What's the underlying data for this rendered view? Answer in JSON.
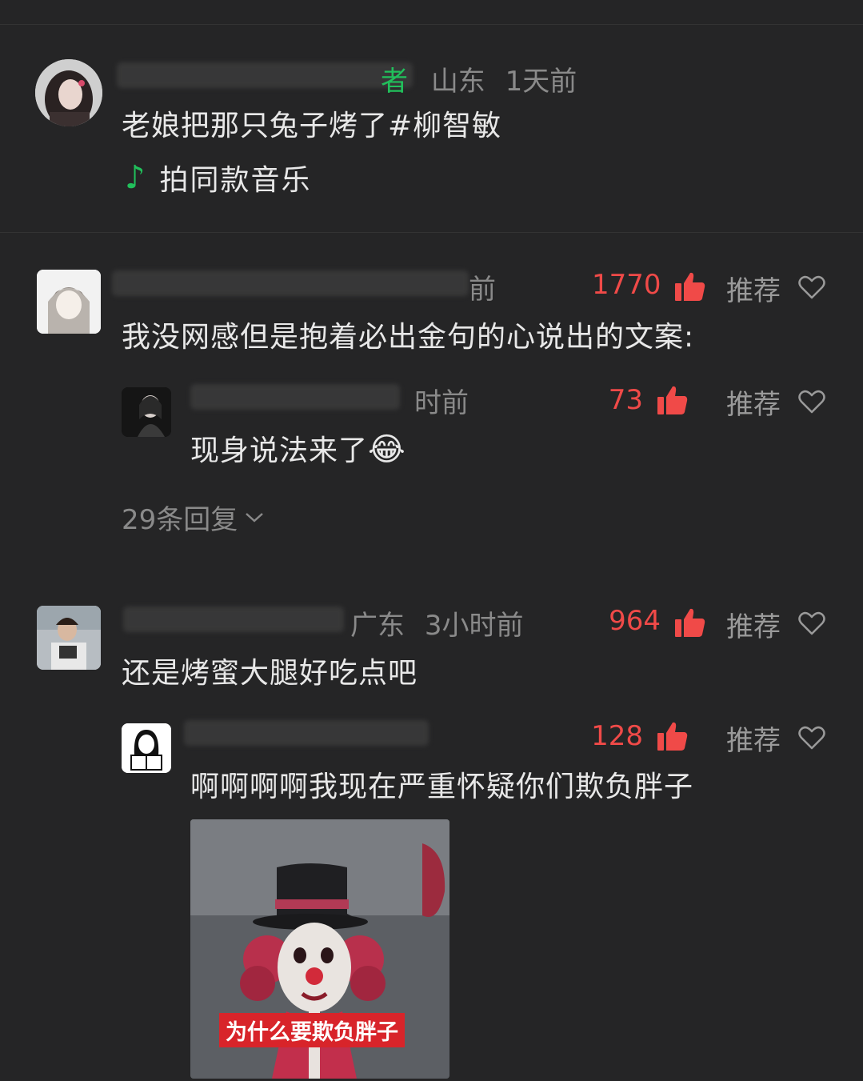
{
  "post": {
    "author_tag": "者",
    "location": "山东",
    "time": "1天前",
    "text": "老娘把那只兔子烤了",
    "hashtag": "#柳智敏",
    "music_label": "拍同款音乐",
    "music_icon": "music-note-icon"
  },
  "comments": [
    {
      "meta_visible": "前",
      "likes": "1770",
      "recommend": "推荐",
      "text": "我没网感但是抱着必出金句的心说出的文案:",
      "reply": {
        "meta_visible": "时前",
        "likes": "73",
        "recommend": "推荐",
        "text": "现身说法来了",
        "emoji": "😂"
      },
      "replies_label": "29条回复"
    },
    {
      "location": "广东",
      "time": "3小时前",
      "likes": "964",
      "recommend": "推荐",
      "text": "还是烤蜜大腿好吃点吧",
      "reply": {
        "likes": "128",
        "recommend": "推荐",
        "text": "啊啊啊啊我现在严重怀疑你们欺负胖子",
        "meme_caption": "为什么要欺负胖子"
      }
    }
  ],
  "colors": {
    "background": "#252526",
    "like_red": "#f04a48",
    "author_green": "#21c05b"
  }
}
